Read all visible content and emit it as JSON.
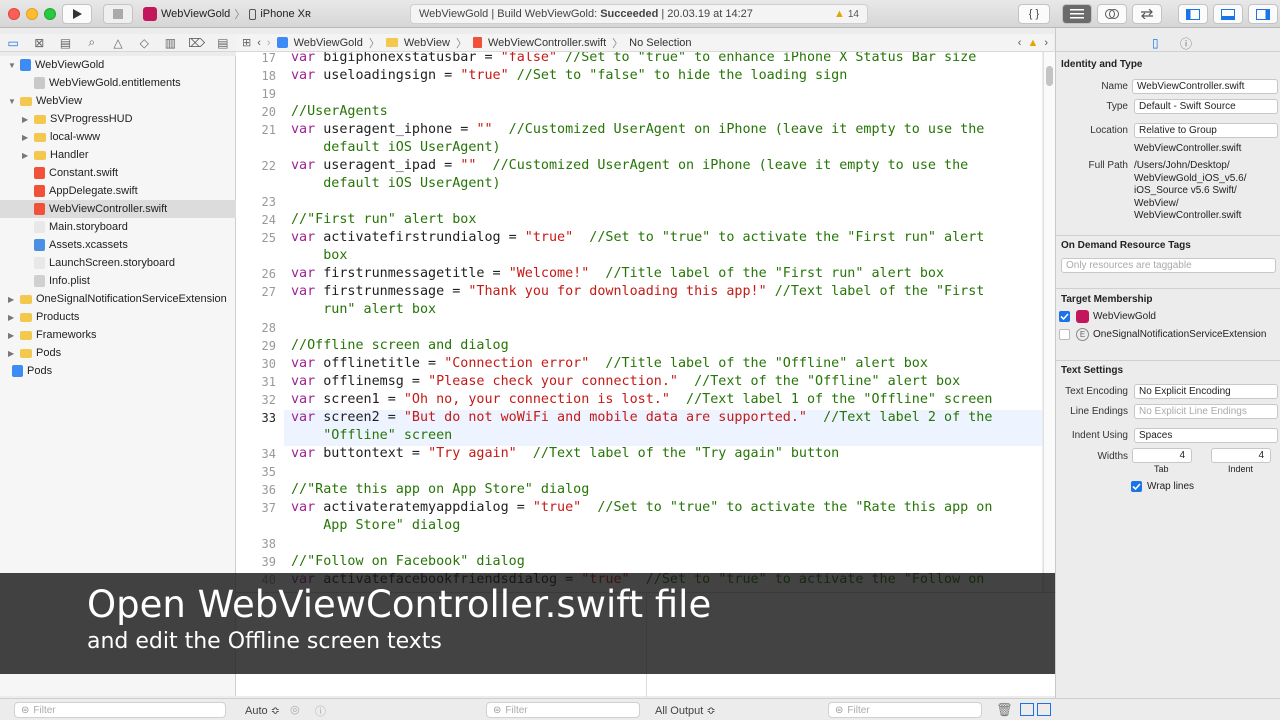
{
  "toolbar": {
    "project_name": "WebViewGold",
    "device": "iPhone Xʀ",
    "status_text": "WebViewGold | Build WebViewGold: ",
    "status_bold": "Succeeded",
    "status_time": " | 20.03.19 at 14:27",
    "warning_count": "14",
    "braces": "{ }"
  },
  "jumpbar": {
    "crumbs": [
      "WebViewGold",
      "WebView",
      "WebViewController.swift",
      "No Selection"
    ]
  },
  "navigator": {
    "items": [
      {
        "label": "WebViewGold",
        "level": 0,
        "icon": "project"
      },
      {
        "label": "WebViewGold.entitlements",
        "level": 1,
        "icon": "file"
      },
      {
        "label": "WebView",
        "level": 0,
        "icon": "folder"
      },
      {
        "label": "SVProgressHUD",
        "level": 1,
        "icon": "folder"
      },
      {
        "label": "local-www",
        "level": 1,
        "icon": "folder"
      },
      {
        "label": "Handler",
        "level": 1,
        "icon": "folder"
      },
      {
        "label": "Constant.swift",
        "level": 1,
        "icon": "swift"
      },
      {
        "label": "AppDelegate.swift",
        "level": 1,
        "icon": "swift"
      },
      {
        "label": "WebViewController.swift",
        "level": 1,
        "icon": "swift"
      },
      {
        "label": "Main.storyboard",
        "level": 1,
        "icon": "storyboard"
      },
      {
        "label": "Assets.xcassets",
        "level": 1,
        "icon": "assets"
      },
      {
        "label": "LaunchScreen.storyboard",
        "level": 1,
        "icon": "storyboard"
      },
      {
        "label": "Info.plist",
        "level": 1,
        "icon": "plist"
      },
      {
        "label": "OneSignalNotificationServiceExtension",
        "level": 0,
        "icon": "folder"
      },
      {
        "label": "Products",
        "level": 0,
        "icon": "folder"
      },
      {
        "label": "Frameworks",
        "level": 0,
        "icon": "folder"
      },
      {
        "label": "Pods",
        "level": 0,
        "icon": "folder"
      },
      {
        "label": "Pods",
        "level": -1,
        "icon": "project"
      }
    ],
    "filter_placeholder": "Filter"
  },
  "editor": {
    "lines": [
      {
        "n": "17",
        "segs": [
          [
            "kw",
            "var "
          ],
          [
            "t",
            "bigiphonexstatusbar = "
          ],
          [
            "str",
            "\"false\""
          ],
          [
            "cm",
            " //Set to \"true\" to enhance iPhone X Status Bar size"
          ]
        ]
      },
      {
        "n": "18",
        "segs": [
          [
            "kw",
            "var "
          ],
          [
            "t",
            "useloadingsign = "
          ],
          [
            "str",
            "\"true\""
          ],
          [
            "cm",
            " //Set to \"false\" to hide the loading sign"
          ]
        ]
      },
      {
        "n": "19",
        "segs": []
      },
      {
        "n": "20",
        "segs": [
          [
            "cm",
            "//UserAgents"
          ]
        ]
      },
      {
        "n": "21",
        "segs": [
          [
            "kw",
            "var "
          ],
          [
            "t",
            "useragent_iphone = "
          ],
          [
            "str",
            "\"\""
          ],
          [
            "cm",
            "  //Customized UserAgent on iPhone (leave it empty to use the"
          ]
        ]
      },
      {
        "n": "",
        "segs": [
          [
            "cm",
            "    default iOS UserAgent)"
          ]
        ]
      },
      {
        "n": "22",
        "segs": [
          [
            "kw",
            "var "
          ],
          [
            "t",
            "useragent_ipad = "
          ],
          [
            "str",
            "\"\""
          ],
          [
            "cm",
            "  //Customized UserAgent on iPhone (leave it empty to use the"
          ]
        ]
      },
      {
        "n": "",
        "segs": [
          [
            "cm",
            "    default iOS UserAgent)"
          ]
        ]
      },
      {
        "n": "23",
        "segs": []
      },
      {
        "n": "24",
        "segs": [
          [
            "cm",
            "//\"First run\" alert box"
          ]
        ]
      },
      {
        "n": "25",
        "segs": [
          [
            "kw",
            "var "
          ],
          [
            "t",
            "activatefirstrundialog = "
          ],
          [
            "str",
            "\"true\""
          ],
          [
            "cm",
            "  //Set to \"true\" to activate the \"First run\" alert"
          ]
        ]
      },
      {
        "n": "",
        "segs": [
          [
            "cm",
            "    box"
          ]
        ]
      },
      {
        "n": "26",
        "segs": [
          [
            "kw",
            "var "
          ],
          [
            "t",
            "firstrunmessagetitle = "
          ],
          [
            "str",
            "\"Welcome!\""
          ],
          [
            "cm",
            "  //Title label of the \"First run\" alert box"
          ]
        ]
      },
      {
        "n": "27",
        "segs": [
          [
            "kw",
            "var "
          ],
          [
            "t",
            "firstrunmessage = "
          ],
          [
            "str",
            "\"Thank you for downloading this app!\""
          ],
          [
            "cm",
            " //Text label of the \"First"
          ]
        ]
      },
      {
        "n": "",
        "segs": [
          [
            "cm",
            "    run\" alert box"
          ]
        ]
      },
      {
        "n": "28",
        "segs": []
      },
      {
        "n": "29",
        "segs": [
          [
            "cm",
            "//Offline screen and dialog"
          ]
        ]
      },
      {
        "n": "30",
        "segs": [
          [
            "kw",
            "var "
          ],
          [
            "t",
            "offlinetitle = "
          ],
          [
            "str",
            "\"Connection error\""
          ],
          [
            "cm",
            "  //Title label of the \"Offline\" alert box"
          ]
        ]
      },
      {
        "n": "31",
        "segs": [
          [
            "kw",
            "var "
          ],
          [
            "t",
            "offlinemsg = "
          ],
          [
            "str",
            "\"Please check your connection.\""
          ],
          [
            "cm",
            "  //Text of the \"Offline\" alert box"
          ]
        ]
      },
      {
        "n": "32",
        "segs": [
          [
            "kw",
            "var "
          ],
          [
            "t",
            "screen1 = "
          ],
          [
            "str",
            "\"Oh no, your connection is lost.\""
          ],
          [
            "cm",
            "  //Text label 1 of the \"Offline\" screen"
          ]
        ]
      },
      {
        "n": "33",
        "segs": [
          [
            "kw",
            "var "
          ],
          [
            "t",
            "screen2 = "
          ],
          [
            "str",
            "\"But do not woWiFi and mobile data are supported.\""
          ],
          [
            "cm",
            "  //Text label 2 of the"
          ]
        ]
      },
      {
        "n": "",
        "segs": [
          [
            "cm",
            "    \"Offline\" screen"
          ]
        ]
      },
      {
        "n": "34",
        "segs": [
          [
            "kw",
            "var "
          ],
          [
            "t",
            "buttontext = "
          ],
          [
            "str",
            "\"Try again\""
          ],
          [
            "cm",
            "  //Text label of the \"Try again\" button"
          ]
        ]
      },
      {
        "n": "35",
        "segs": []
      },
      {
        "n": "36",
        "segs": [
          [
            "cm",
            "//\"Rate this app on App Store\" dialog"
          ]
        ]
      },
      {
        "n": "37",
        "segs": [
          [
            "kw",
            "var "
          ],
          [
            "t",
            "activateratemyappdialog = "
          ],
          [
            "str",
            "\"true\""
          ],
          [
            "cm",
            "  //Set to \"true\" to activate the \"Rate this app on"
          ]
        ]
      },
      {
        "n": "",
        "segs": [
          [
            "cm",
            "    App Store\" dialog"
          ]
        ]
      },
      {
        "n": "38",
        "segs": []
      },
      {
        "n": "39",
        "segs": [
          [
            "cm",
            "//\"Follow on Facebook\" dialog"
          ]
        ]
      },
      {
        "n": "40",
        "segs": [
          [
            "kw",
            "var "
          ],
          [
            "t",
            "activatefacebookfriendsdialog = "
          ],
          [
            "str",
            "\"true\""
          ],
          [
            "cm",
            "  //Set to \"true\" to activate the \"Follow on"
          ]
        ]
      }
    ],
    "current_line": "33"
  },
  "inspector": {
    "identity_header": "Identity and Type",
    "name_label": "Name",
    "name_value": "WebViewController.swift",
    "type_label": "Type",
    "type_value": "Default - Swift Source",
    "location_label": "Location",
    "location_value": "Relative to Group",
    "location_file": "WebViewController.swift",
    "fullpath_label": "Full Path",
    "fullpath_lines": [
      "/Users/John/Desktop/",
      "WebViewGold_iOS_v5.6/",
      "iOS_Source v5.6 Swift/",
      "WebView/",
      "WebViewController.swift"
    ],
    "odr_header": "On Demand Resource Tags",
    "odr_placeholder": "Only resources are taggable",
    "target_header": "Target Membership",
    "targets": [
      {
        "label": "WebViewGold",
        "checked": true
      },
      {
        "label": "OneSignalNotificationServiceExtension",
        "checked": false
      }
    ],
    "text_header": "Text Settings",
    "encoding_label": "Text Encoding",
    "encoding_value": "No Explicit Encoding",
    "endings_label": "Line Endings",
    "endings_value": "No Explicit Line Endings",
    "indent_label": "Indent Using",
    "indent_value": "Spaces",
    "widths_label": "Widths",
    "tab_value": "4",
    "indent_value_num": "4",
    "tab_caption": "Tab",
    "indent_caption": "Indent",
    "wrap_label": "Wrap lines"
  },
  "bottombar": {
    "nav_filter": "Filter",
    "auto_label": "Auto ≎",
    "var_filter": "Filter",
    "output_label": "All Output ≎",
    "console_filter": "Filter"
  },
  "overlay": {
    "title": "Open WebViewController.swift file",
    "subtitle": "and edit the Offline screen texts"
  },
  "colors": {
    "keyword": "#9b2393",
    "string": "#c41a16",
    "comment": "#267507",
    "accent": "#1b73e8"
  }
}
